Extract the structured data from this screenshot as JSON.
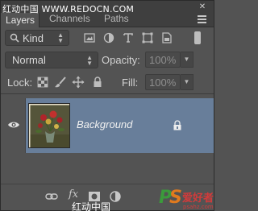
{
  "watermark": {
    "top_text": "红动中国 WWW.REDOCN.COM",
    "bottom_text": "红动中国",
    "logo_text": "PS爱好者",
    "logo_subtext": "psahz.com"
  },
  "tabs": [
    {
      "label": "Layers",
      "active": true
    },
    {
      "label": "Channels",
      "active": false
    },
    {
      "label": "Paths",
      "active": false
    }
  ],
  "filter": {
    "kind_label": "Kind",
    "icons": [
      "pixel-filter-icon",
      "adjustment-filter-icon",
      "type-filter-icon",
      "shape-filter-icon",
      "smart-object-filter-icon"
    ]
  },
  "blend": {
    "mode": "Normal",
    "opacity_label": "Opacity:",
    "opacity_value": "100%"
  },
  "lock": {
    "label": "Lock:",
    "fill_label": "Fill:",
    "fill_value": "100%"
  },
  "layers": [
    {
      "name": "Background",
      "visible": true,
      "locked": true,
      "selected": true
    }
  ],
  "colors": {
    "panel_bg": "#535353",
    "selection": "#687e9a",
    "text": "#d6d6d6"
  }
}
